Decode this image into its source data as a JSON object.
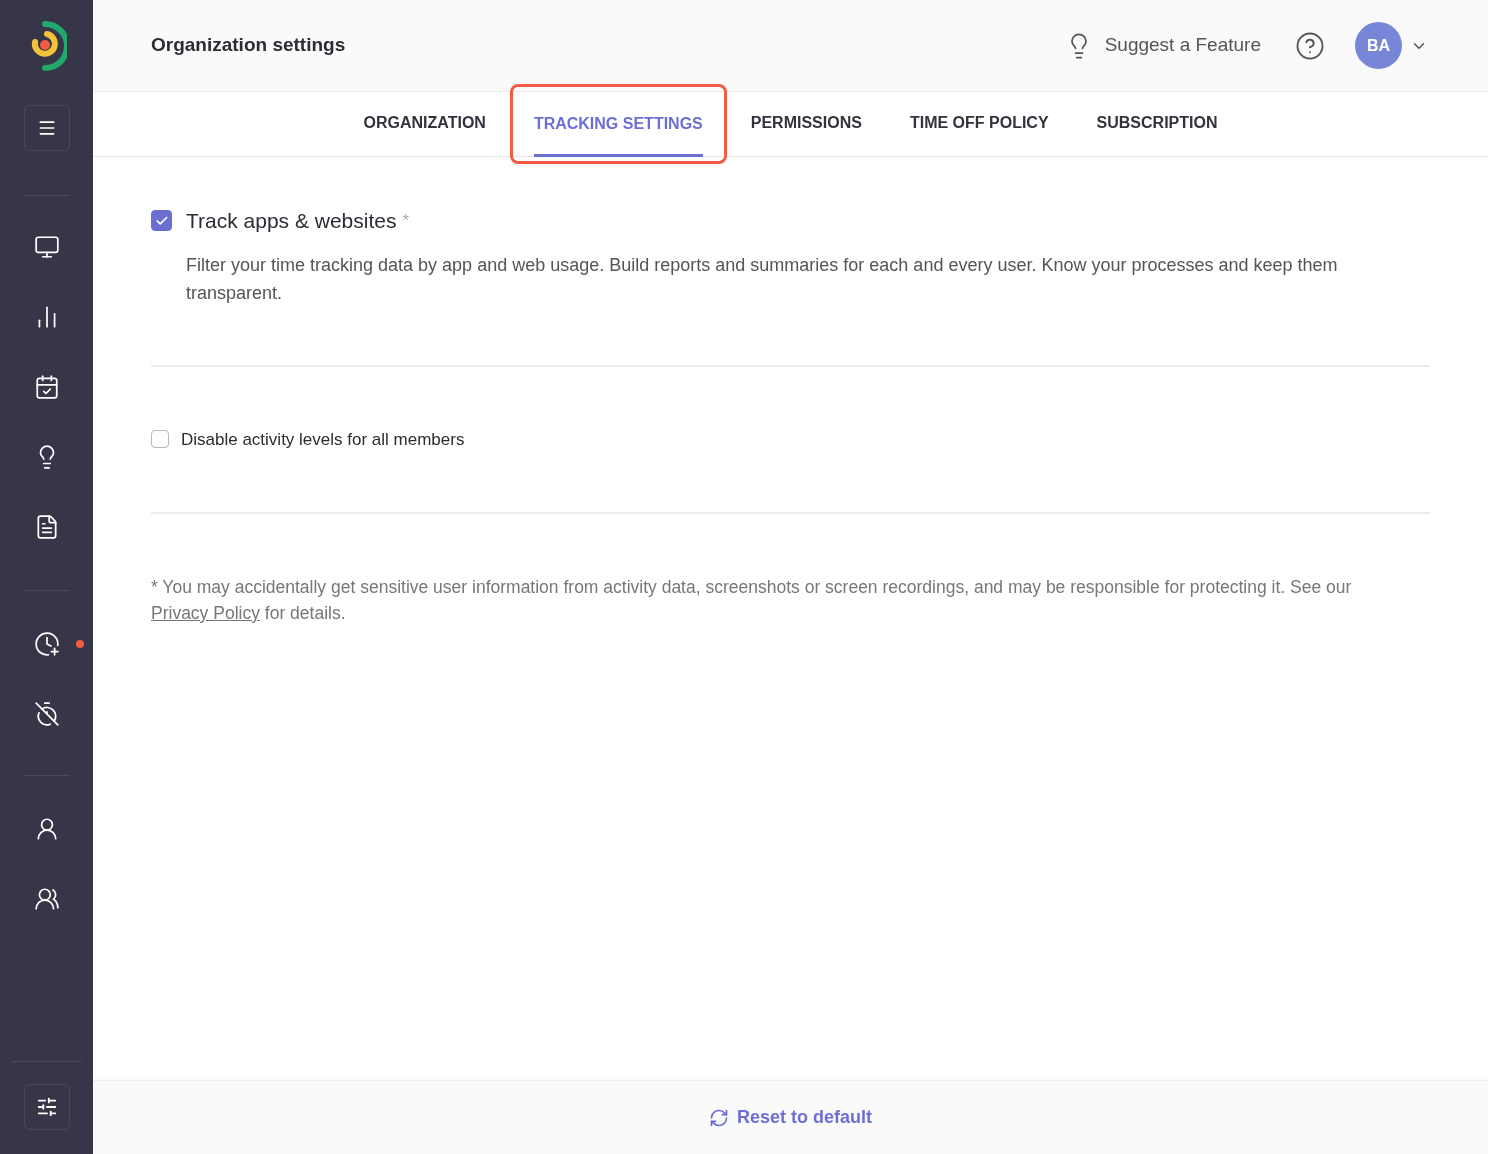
{
  "header": {
    "title": "Organization settings",
    "suggest": "Suggest a Feature",
    "avatar": "BA"
  },
  "sidebar": {
    "top": [
      {
        "kind": "dashboard",
        "notification": false
      },
      {
        "kind": "reports",
        "notification": false
      },
      {
        "kind": "calendar",
        "notification": false
      },
      {
        "kind": "insights",
        "notification": false
      },
      {
        "kind": "documents",
        "notification": false
      }
    ],
    "middle": [
      {
        "kind": "add-time",
        "notification": true
      },
      {
        "kind": "time-off",
        "notification": false
      }
    ],
    "people": [
      {
        "kind": "member",
        "notification": false
      },
      {
        "kind": "team",
        "notification": false
      }
    ]
  },
  "tabs": [
    {
      "label": "ORGANIZATION",
      "selected": false
    },
    {
      "label": "TRACKING SETTINGS",
      "selected": true
    },
    {
      "label": "PERMISSIONS",
      "selected": false
    },
    {
      "label": "TIME OFF POLICY",
      "selected": false
    },
    {
      "label": "SUBSCRIPTION",
      "selected": false
    }
  ],
  "settings": [
    {
      "kind": "major",
      "label": "Track apps & websites",
      "required": "*",
      "checked": true,
      "description": "Filter your time tracking data by app and web usage. Build reports and summaries for each and every user. Know your processes and keep them transparent."
    },
    {
      "kind": "minor",
      "label": "Disable activity levels for all members",
      "checked": false
    }
  ],
  "footnote": {
    "before": "* You may accidentally get sensitive user information from activity data, screenshots or screen recordings, and may be responsible for protecting it. See our",
    "link": "Privacy Policy",
    "after": "for details."
  },
  "footer": {
    "button": "Reset to default"
  }
}
